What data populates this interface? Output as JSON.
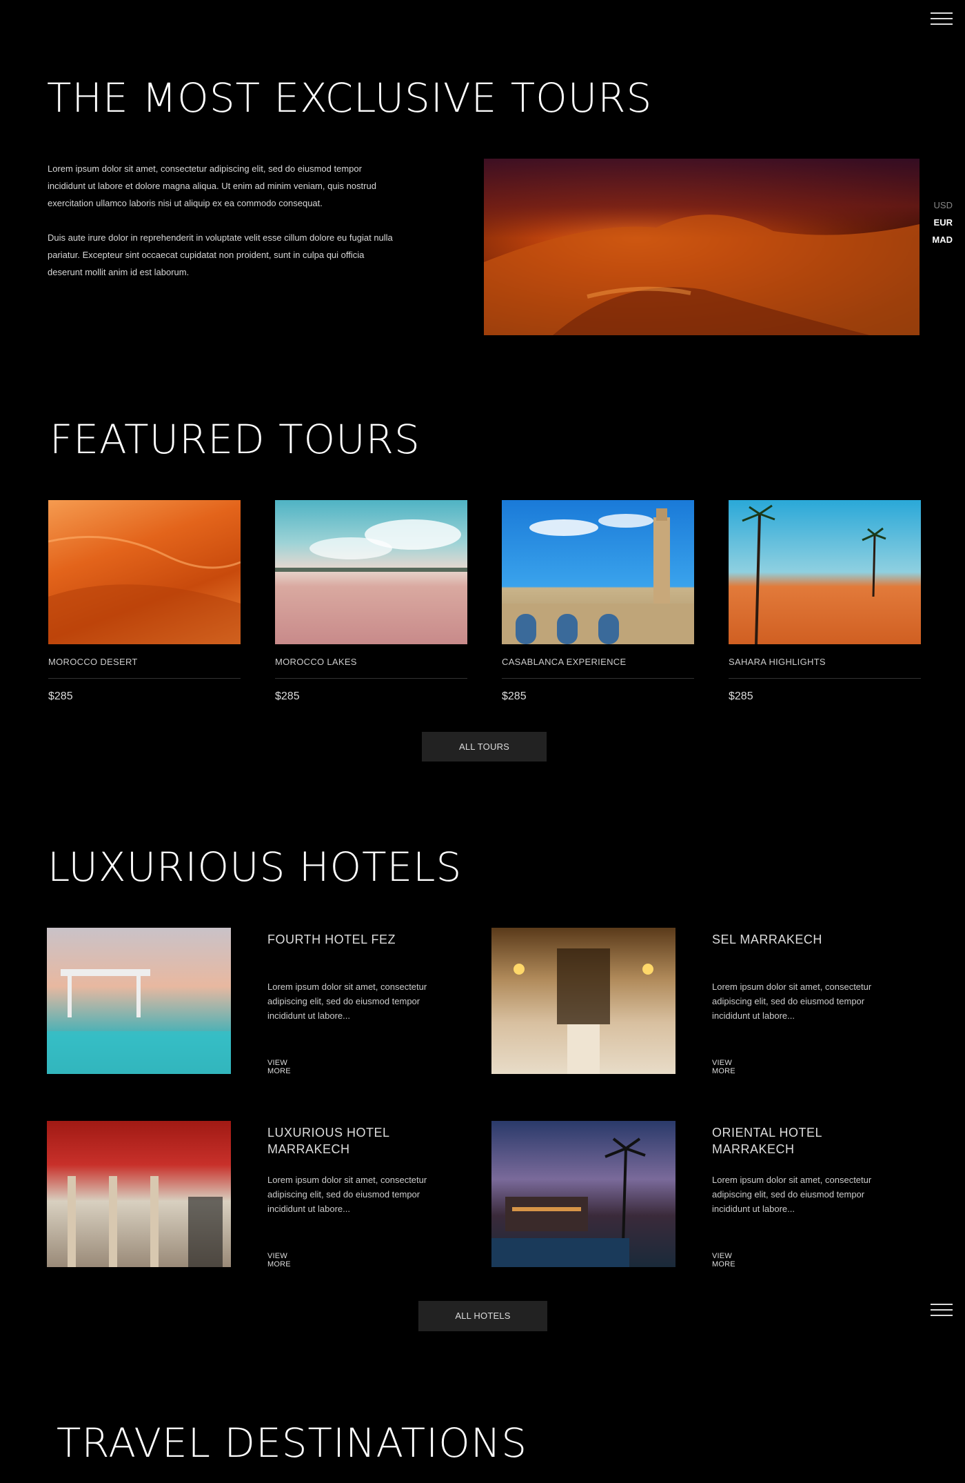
{
  "header": {
    "menu_icon": "hamburger-menu-icon"
  },
  "currency": {
    "options": [
      "USD",
      "EUR",
      "MAD"
    ],
    "selected": "EUR"
  },
  "intro": {
    "title": "THE MOST EXCLUSIVE TOURS",
    "paragraph1": "Lorem ipsum dolor sit amet, consectetur adipiscing elit, sed do eiusmod tempor incididunt ut labore et dolore magna aliqua. Ut enim ad minim veniam, quis nostrud exercitation ullamco laboris nisi ut aliquip ex ea commodo consequat.",
    "paragraph2": "Duis aute irure dolor in reprehenderit in voluptate velit esse cillum dolore eu fugiat nulla pariatur. Excepteur sint occaecat cupidatat non proident, sunt in culpa qui officia deserunt mollit anim id est laborum."
  },
  "featured": {
    "title": "FEATURED TOURS",
    "tours": [
      {
        "name": "MOROCCO DESERT",
        "price": "$285"
      },
      {
        "name": "MOROCCO LAKES",
        "price": "$285"
      },
      {
        "name": "CASABLANCA EXPERIENCE",
        "price": "$285"
      },
      {
        "name": "SAHARA HIGHLIGHTS",
        "price": "$285"
      }
    ],
    "button_label": "ALL TOURS"
  },
  "hotels": {
    "title": "LUXURIOUS HOTELS",
    "items": [
      {
        "name": "FOURTH HOTEL FEZ",
        "desc": "Lorem ipsum dolor sit amet, consectetur adipiscing elit, sed do eiusmod tempor incididunt ut labore...",
        "link": "VIEW MORE"
      },
      {
        "name": "SEL MARRAKECH",
        "desc": "Lorem ipsum dolor sit amet, consectetur adipiscing elit, sed do eiusmod tempor incididunt ut labore...",
        "link": "VIEW MORE"
      },
      {
        "name": "LUXURIOUS HOTEL MARRAKECH",
        "desc": "Lorem ipsum dolor sit amet, consectetur adipiscing elit, sed do eiusmod tempor incididunt ut labore...",
        "link": "VIEW MORE"
      },
      {
        "name": "ORIENTAL HOTEL MARRAKECH",
        "desc": "Lorem ipsum dolor sit amet, consectetur adipiscing elit, sed do eiusmod tempor incididunt ut labore...",
        "link": "VIEW MORE"
      }
    ],
    "button_label": "ALL HOTELS"
  },
  "destinations": {
    "title": "TRAVEL DESTINATIONS"
  }
}
